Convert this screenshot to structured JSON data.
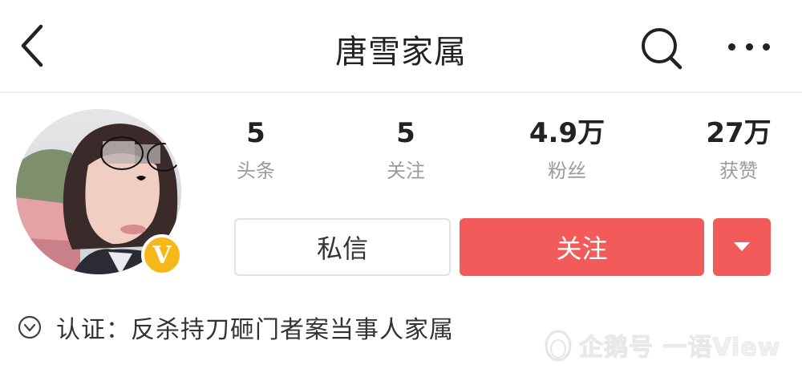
{
  "header": {
    "title": "唐雪家属",
    "back_icon": "chevron-left-icon",
    "search_icon": "search-icon",
    "more_icon": "more-horizontal-icon"
  },
  "profile": {
    "verified_badge": "V",
    "stats": [
      {
        "value": "5",
        "label": "头条"
      },
      {
        "value": "5",
        "label": "关注"
      },
      {
        "value": "4.9万",
        "label": "粉丝"
      },
      {
        "value": "27万",
        "label": "获赞"
      }
    ],
    "message_button": "私信",
    "follow_button": "关注",
    "verification": "认证：反杀持刀砸门者案当事人家属"
  },
  "watermark": {
    "text": "企鹅号 一语View"
  },
  "colors": {
    "accent": "#f35b5b",
    "badge": "#f6b718",
    "label_gray": "#9b9b9b"
  }
}
